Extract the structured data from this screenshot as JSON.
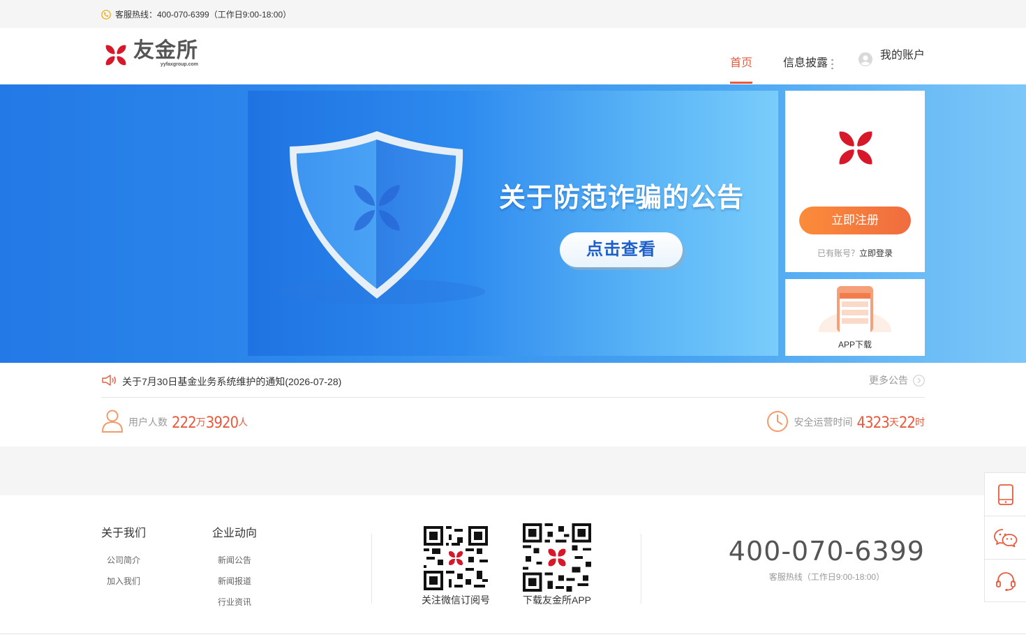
{
  "topbar": {
    "hotline_text": "客服热线：400-070-6399（工作日9:00-18:00）",
    "icon": "phone-icon"
  },
  "header": {
    "logo_cn": "友金所",
    "logo_en": "yyfaxgroup.com",
    "nav": [
      {
        "label": "首页",
        "active": true
      },
      {
        "label": "信息披露",
        "active": false
      }
    ],
    "account_label": "我的账户"
  },
  "banner": {
    "title": "关于防范诈骗的公告",
    "cta": "点击查看"
  },
  "register_card": {
    "button": "立即注册",
    "login_prompt": "已有账号？",
    "login_link": "立即登录"
  },
  "app_card": {
    "label": "APP下载"
  },
  "notice": {
    "text": "关于7月30日基金业务系统维护的通知(2026-07-28)",
    "more": "更多公告"
  },
  "stats": {
    "users": {
      "label": "用户人数",
      "num1": "222",
      "unit1": "万",
      "num2": "3920",
      "unit2": "人"
    },
    "uptime": {
      "label": "安全运营时间",
      "num1": "4323",
      "unit1": "天",
      "num2": "22",
      "unit2": "时"
    }
  },
  "footer": {
    "about": {
      "title": "关于我们",
      "links": [
        "公司简介",
        "加入我们"
      ]
    },
    "news": {
      "title": "企业动向",
      "links": [
        "新闻公告",
        "新闻报道",
        "行业资讯"
      ]
    },
    "qr_wechat": "关注微信订阅号",
    "qr_app": "下载友金所APP",
    "hotline": "400-070-6399",
    "hotline_hours": "客服热线（工作日9:00-18:00）"
  },
  "colors": {
    "accent": "#e85a3c",
    "brand_red": "#d7182a",
    "banner_blue": "#2d88ec"
  }
}
